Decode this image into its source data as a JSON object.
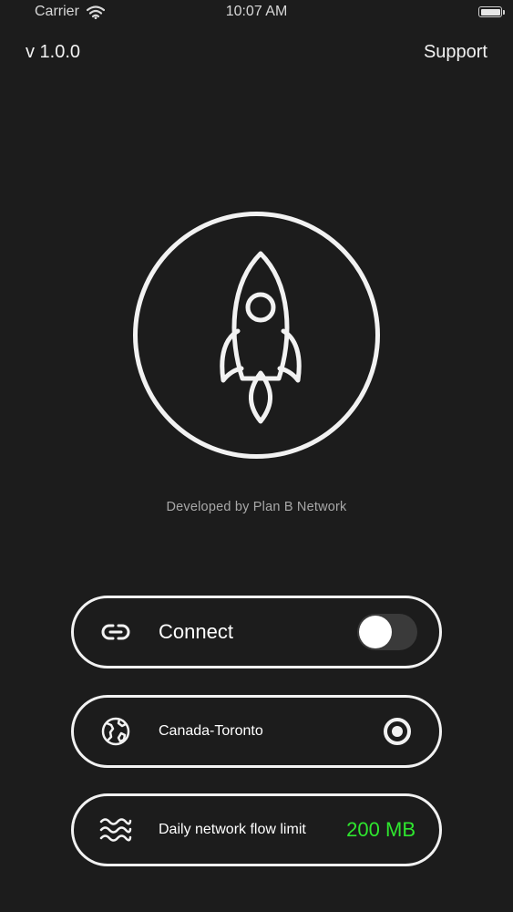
{
  "status_bar": {
    "carrier": "Carrier",
    "time": "10:07 AM",
    "icons": [
      "wifi-icon",
      "battery-icon"
    ]
  },
  "header": {
    "version": "v 1.0.0",
    "support_label": "Support"
  },
  "hero": {
    "icon": "rocket-icon",
    "developer_text": "Developed by Plan B Network"
  },
  "connect": {
    "icon": "link-icon",
    "label": "Connect",
    "enabled": false
  },
  "location": {
    "icon": "globe-icon",
    "label": "Canada-Toronto",
    "selected": true
  },
  "flow_limit": {
    "icon": "waves-icon",
    "label": "Daily network flow limit",
    "value": "200 MB"
  },
  "colors": {
    "background": "#1c1c1c",
    "foreground": "#f2f2f2",
    "muted_text": "#a8a8a8",
    "accent_green": "#2ee62e",
    "toggle_track": "#3a3a3a"
  }
}
